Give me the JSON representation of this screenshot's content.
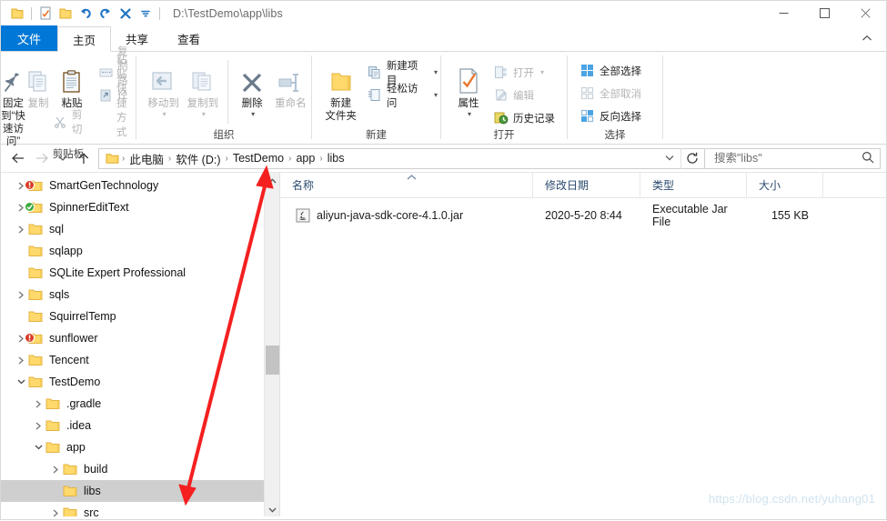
{
  "window": {
    "path_title": "D:\\TestDemo\\app\\libs",
    "minimize": "Minimize",
    "maximize": "Maximize",
    "close": "Close"
  },
  "quick_access": [
    {
      "name": "folder-icon",
      "label": "文件资源管理器"
    },
    {
      "name": "properties-icon",
      "label": "属性"
    },
    {
      "name": "new-folder-icon",
      "label": "新建文件夹"
    },
    {
      "name": "undo-icon",
      "label": "撤销"
    },
    {
      "name": "redo-icon",
      "label": "重做"
    },
    {
      "name": "delete-icon",
      "label": "删除"
    },
    {
      "name": "customize-icon",
      "label": "自定义快速访问工具栏"
    }
  ],
  "tabs": [
    {
      "id": "file",
      "label": "文件"
    },
    {
      "id": "home",
      "label": "主页"
    },
    {
      "id": "share",
      "label": "共享"
    },
    {
      "id": "view",
      "label": "查看"
    }
  ],
  "ribbon": {
    "collapse_icon": "⌃",
    "groups": [
      {
        "id": "clipboard",
        "label": "剪贴板",
        "big": [
          {
            "id": "pin",
            "label": "固定到“快\n速访问”",
            "dim": false
          },
          {
            "id": "copy",
            "label": "复制",
            "dim": true
          },
          {
            "id": "paste",
            "label": "粘贴",
            "dim": false
          }
        ],
        "small_under_paste": [
          {
            "id": "cut",
            "label": "剪切",
            "dim": true
          }
        ],
        "small": [
          {
            "id": "copy-path",
            "label": "复制路径",
            "dim": true
          },
          {
            "id": "paste-shortcut",
            "label": "粘贴快捷方式",
            "dim": true
          }
        ]
      },
      {
        "id": "organize",
        "label": "组织",
        "big": [
          {
            "id": "move-to",
            "label": "移动到",
            "dim": true,
            "caret": true
          },
          {
            "id": "copy-to",
            "label": "复制到",
            "dim": true,
            "caret": true
          },
          {
            "id": "delete",
            "label": "删除",
            "dim": false,
            "caret": true
          },
          {
            "id": "rename",
            "label": "重命名",
            "dim": true
          }
        ]
      },
      {
        "id": "new",
        "label": "新建",
        "big": [
          {
            "id": "new-folder",
            "label": "新建\n文件夹",
            "dim": false
          }
        ],
        "small": [
          {
            "id": "new-item",
            "label": "新建项目",
            "dim": false,
            "caret": true
          },
          {
            "id": "easy-access",
            "label": "轻松访问",
            "dim": false,
            "caret": true
          }
        ]
      },
      {
        "id": "open",
        "label": "打开",
        "big": [
          {
            "id": "properties",
            "label": "属性",
            "dim": false,
            "caret": true
          }
        ],
        "small": [
          {
            "id": "open",
            "label": "打开",
            "dim": true,
            "caret": true
          },
          {
            "id": "edit",
            "label": "编辑",
            "dim": true
          },
          {
            "id": "history",
            "label": "历史记录",
            "dim": false
          }
        ]
      },
      {
        "id": "select",
        "label": "选择",
        "small": [
          {
            "id": "select-all",
            "label": "全部选择",
            "dim": false
          },
          {
            "id": "select-none",
            "label": "全部取消",
            "dim": true
          },
          {
            "id": "invert-selection",
            "label": "反向选择",
            "dim": false
          }
        ]
      }
    ]
  },
  "address_bar": {
    "back": "←",
    "forward": "→",
    "recent": "⌄",
    "up": "↑",
    "refresh": "↻",
    "breadcrumbs": [
      "此电脑",
      "软件 (D:)",
      "TestDemo",
      "app",
      "libs"
    ],
    "separator": "›"
  },
  "search": {
    "placeholder": "搜索\"libs\"",
    "value": "",
    "icon": "search-icon"
  },
  "nav_tree": {
    "items": [
      {
        "label": "SmartGenTechnology",
        "indent": 1,
        "chevron": "collapsed",
        "badge": "error",
        "selected": false
      },
      {
        "label": "SpinnerEditText",
        "indent": 1,
        "chevron": "collapsed",
        "badge": "ok",
        "selected": false
      },
      {
        "label": "sql",
        "indent": 1,
        "chevron": "collapsed",
        "badge": "none",
        "selected": false
      },
      {
        "label": "sqlapp",
        "indent": 1,
        "chevron": "none",
        "badge": "none",
        "selected": false
      },
      {
        "label": "SQLite Expert Professional",
        "indent": 1,
        "chevron": "none",
        "badge": "none",
        "selected": false
      },
      {
        "label": "sqls",
        "indent": 1,
        "chevron": "collapsed",
        "badge": "none",
        "selected": false
      },
      {
        "label": "SquirrelTemp",
        "indent": 1,
        "chevron": "none",
        "badge": "none",
        "selected": false
      },
      {
        "label": "sunflower",
        "indent": 1,
        "chevron": "collapsed",
        "badge": "error",
        "selected": false
      },
      {
        "label": "Tencent",
        "indent": 1,
        "chevron": "collapsed",
        "badge": "none",
        "selected": false
      },
      {
        "label": "TestDemo",
        "indent": 1,
        "chevron": "expanded",
        "badge": "none",
        "selected": false
      },
      {
        "label": ".gradle",
        "indent": 2,
        "chevron": "collapsed",
        "badge": "none",
        "selected": false
      },
      {
        "label": ".idea",
        "indent": 2,
        "chevron": "collapsed",
        "badge": "none",
        "selected": false
      },
      {
        "label": "app",
        "indent": 2,
        "chevron": "expanded",
        "badge": "none",
        "selected": false
      },
      {
        "label": "build",
        "indent": 3,
        "chevron": "collapsed",
        "badge": "none",
        "selected": false
      },
      {
        "label": "libs",
        "indent": 3,
        "chevron": "none",
        "badge": "none",
        "selected": true
      },
      {
        "label": "src",
        "indent": 3,
        "chevron": "collapsed",
        "badge": "none",
        "selected": false
      }
    ],
    "scroll_up": "⌃",
    "scroll_down": "⌄"
  },
  "file_list": {
    "columns": [
      {
        "id": "name",
        "label": "名称",
        "sorted": true,
        "sort_dir": "asc"
      },
      {
        "id": "date",
        "label": "修改日期",
        "sorted": false
      },
      {
        "id": "type",
        "label": "类型",
        "sorted": false
      },
      {
        "id": "size",
        "label": "大小",
        "sorted": false
      }
    ],
    "rows": [
      {
        "icon": "jar-file-icon",
        "name": "aliyun-java-sdk-core-4.1.0.jar",
        "date": "2020-5-20 8:44",
        "type": "Executable Jar File",
        "size": "155 KB"
      }
    ]
  },
  "annotation": {
    "arrow_color": "#f42020",
    "description": "双向红色箭头"
  },
  "watermark": "https://blog.csdn.net/yuhang01",
  "colors": {
    "accent": "#0078d7",
    "folder": "#ffd96b",
    "folder_edge": "#e8b63a",
    "selection": "#cfcfcf",
    "column_header_text": "#2b4a6f",
    "arrow_red": "#f42020"
  }
}
